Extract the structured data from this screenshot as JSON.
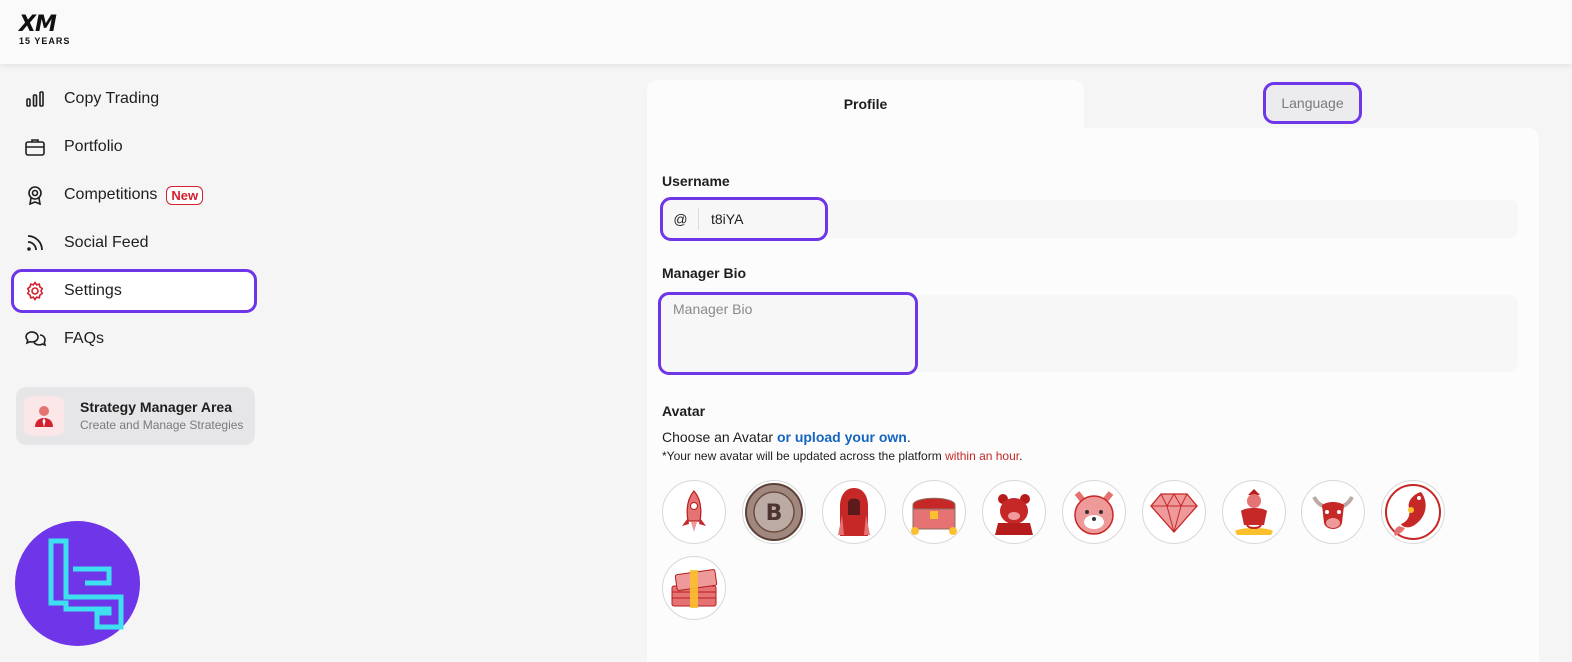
{
  "logo": {
    "brand": "XM",
    "tagline": "15 YEARS"
  },
  "sidebar": {
    "items": [
      {
        "label": "Copy Trading",
        "icon": "bar-chart-icon"
      },
      {
        "label": "Portfolio",
        "icon": "briefcase-icon"
      },
      {
        "label": "Competitions",
        "icon": "award-icon",
        "badge": "New"
      },
      {
        "label": "Social Feed",
        "icon": "rss-icon"
      },
      {
        "label": "Settings",
        "icon": "gear-icon",
        "active": true
      },
      {
        "label": "FAQs",
        "icon": "chat-bubbles-icon"
      }
    ],
    "strategy_manager": {
      "title": "Strategy Manager Area",
      "subtitle": "Create and Manage Strategies"
    }
  },
  "tabs": {
    "profile": "Profile",
    "language": "Language"
  },
  "form": {
    "username_label": "Username",
    "username_prefix": "@",
    "username_value": "t8iYA",
    "bio_label": "Manager Bio",
    "bio_placeholder": "Manager Bio",
    "avatar_label": "Avatar",
    "avatar_choose_text": "Choose an Avatar ",
    "avatar_upload_link": "or upload your own",
    "avatar_choose_end": ".",
    "avatar_note_text": "*Your new avatar will be updated across the platform ",
    "avatar_note_highlight": "within an hour",
    "avatar_note_end": "."
  },
  "avatars": [
    "rocket",
    "bitcoin-coin",
    "hooded-figure",
    "treasure-chest",
    "bear",
    "shiba-dog",
    "diamond",
    "genie",
    "bull",
    "koi-fish",
    "money-stack"
  ],
  "colors": {
    "accent": "#6f35e8",
    "brand_red": "#d2202f",
    "link_blue": "#1565c0"
  }
}
